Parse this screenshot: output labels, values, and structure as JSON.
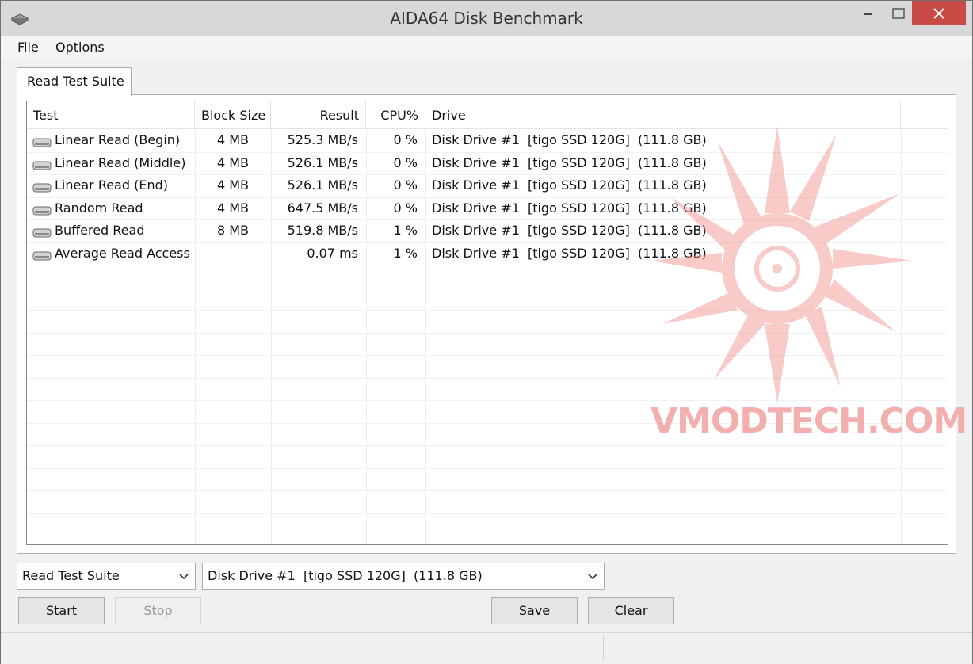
{
  "window": {
    "title": "AIDA64 Disk Benchmark"
  },
  "menu": {
    "file": "File",
    "options": "Options"
  },
  "tab": {
    "label": "Read Test Suite"
  },
  "grid": {
    "headers": {
      "test": "Test",
      "block": "Block Size",
      "result": "Result",
      "cpu": "CPU%",
      "drive": "Drive"
    },
    "rows": [
      {
        "test": "Linear Read (Begin)",
        "block": "4 MB",
        "result": "525.3 MB/s",
        "cpu": "0 %",
        "drive": "Disk Drive #1  [tigo SSD 120G]  (111.8 GB)"
      },
      {
        "test": "Linear Read (Middle)",
        "block": "4 MB",
        "result": "526.1 MB/s",
        "cpu": "0 %",
        "drive": "Disk Drive #1  [tigo SSD 120G]  (111.8 GB)"
      },
      {
        "test": "Linear Read (End)",
        "block": "4 MB",
        "result": "526.1 MB/s",
        "cpu": "0 %",
        "drive": "Disk Drive #1  [tigo SSD 120G]  (111.8 GB)"
      },
      {
        "test": "Random Read",
        "block": "4 MB",
        "result": "647.5 MB/s",
        "cpu": "0 %",
        "drive": "Disk Drive #1  [tigo SSD 120G]  (111.8 GB)"
      },
      {
        "test": "Buffered Read",
        "block": "8 MB",
        "result": "519.8 MB/s",
        "cpu": "1 %",
        "drive": "Disk Drive #1  [tigo SSD 120G]  (111.8 GB)"
      },
      {
        "test": "Average Read Access",
        "block": "",
        "result": "0.07 ms",
        "cpu": "1 %",
        "drive": "Disk Drive #1  [tigo SSD 120G]  (111.8 GB)"
      }
    ]
  },
  "watermark": {
    "text": "VMODTECH.COM"
  },
  "controls": {
    "suite_select": "Read Test Suite",
    "drive_select": "Disk Drive #1  [tigo SSD 120G]  (111.8 GB)",
    "start": "Start",
    "stop": "Stop",
    "save": "Save",
    "clear": "Clear"
  },
  "colors": {
    "close_button": "#c94b46",
    "watermark": "#f1a7a5"
  }
}
